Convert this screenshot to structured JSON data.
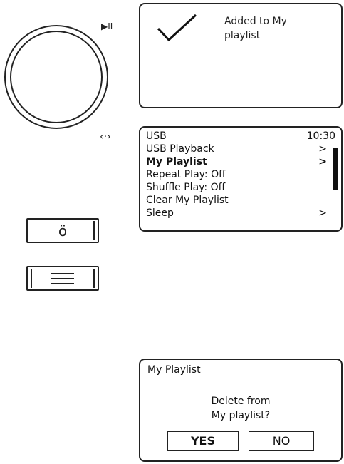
{
  "controls": {
    "play_pause_glyph": "▶II",
    "nav_glyph": "‹·›",
    "alarm_icon": "alarm-icon",
    "menu_icon": "menu-icon"
  },
  "screen_added": {
    "icon": "check-icon",
    "message": "Added to My playlist"
  },
  "screen_menu": {
    "title": "USB",
    "time": "10:30",
    "items": [
      {
        "label": "USB Playback",
        "arrow": ">"
      },
      {
        "label": "My Playlist",
        "arrow": ">"
      },
      {
        "label": "Repeat Play: Off",
        "arrow": ""
      },
      {
        "label": "Shuffle Play: Off",
        "arrow": ""
      },
      {
        "label": "Clear My Playlist",
        "arrow": ""
      },
      {
        "label": "Sleep",
        "arrow": ">"
      }
    ],
    "selected_index": 1
  },
  "screen_confirm": {
    "title": "My Playlist",
    "line1": "Delete from",
    "line2": "My playlist?",
    "yes_label": "YES",
    "no_label": "NO",
    "selected": "YES"
  }
}
